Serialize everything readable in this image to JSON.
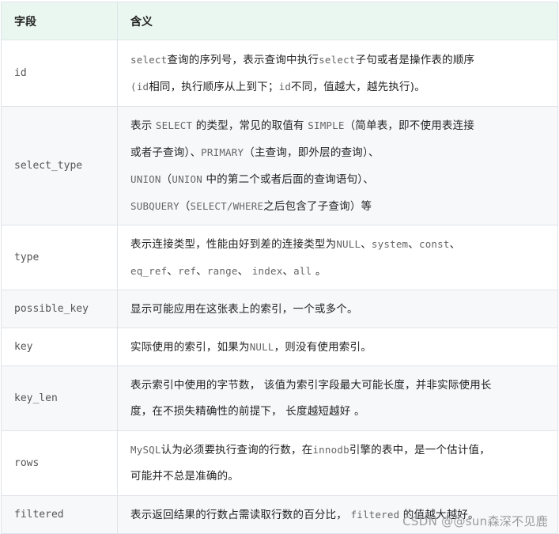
{
  "table": {
    "headers": {
      "field": "字段",
      "meaning": "含义"
    },
    "rows": [
      {
        "field": "id",
        "lines": [
          [
            {
              "t": "select",
              "code": true
            },
            {
              "t": "查询的序列号，表示查询中执行"
            },
            {
              "t": "select",
              "code": true
            },
            {
              "t": "子句或者是操作表的顺序"
            }
          ],
          [
            {
              "t": "(",
              "code": true
            },
            {
              "t": "id",
              "code": true
            },
            {
              "t": "相同，执行顺序从上到下；"
            },
            {
              "t": "id",
              "code": true
            },
            {
              "t": "不同，值越大，越先执行)。"
            }
          ]
        ]
      },
      {
        "field": "select_type",
        "lines": [
          [
            {
              "t": "表示 "
            },
            {
              "t": "SELECT",
              "code": true
            },
            {
              "t": " 的类型，常见的取值有 "
            },
            {
              "t": "SIMPLE",
              "code": true
            },
            {
              "t": "（简单表，即不使用表连接"
            }
          ],
          [
            {
              "t": "或者子查询）、"
            },
            {
              "t": "PRIMARY",
              "code": true
            },
            {
              "t": "（主查询，即外层的查询）、"
            }
          ],
          [
            {
              "t": "UNION",
              "code": true
            },
            {
              "t": "（"
            },
            {
              "t": "UNION",
              "code": true
            },
            {
              "t": " 中的第二个或者后面的查询语句）、"
            }
          ],
          [
            {
              "t": "SUBQUERY",
              "code": true
            },
            {
              "t": "（"
            },
            {
              "t": "SELECT/WHERE",
              "code": true
            },
            {
              "t": "之后包含了子查询）等"
            }
          ]
        ]
      },
      {
        "field": "type",
        "lines": [
          [
            {
              "t": "表示连接类型，性能由好到差的连接类型为"
            },
            {
              "t": "NULL",
              "code": true
            },
            {
              "t": "、"
            },
            {
              "t": "system",
              "code": true
            },
            {
              "t": "、"
            },
            {
              "t": "const",
              "code": true
            },
            {
              "t": "、"
            }
          ],
          [
            {
              "t": "eq_ref",
              "code": true
            },
            {
              "t": "、"
            },
            {
              "t": "ref",
              "code": true
            },
            {
              "t": "、"
            },
            {
              "t": "range",
              "code": true
            },
            {
              "t": "、 "
            },
            {
              "t": "index",
              "code": true
            },
            {
              "t": "、"
            },
            {
              "t": "all",
              "code": true
            },
            {
              "t": " 。"
            }
          ]
        ]
      },
      {
        "field": "possible_key",
        "lines": [
          [
            {
              "t": "显示可能应用在这张表上的索引，一个或多个。"
            }
          ]
        ]
      },
      {
        "field": "key",
        "lines": [
          [
            {
              "t": "实际使用的索引，如果为"
            },
            {
              "t": "NULL",
              "code": true
            },
            {
              "t": "，则没有使用索引。"
            }
          ]
        ]
      },
      {
        "field": "key_len",
        "lines": [
          [
            {
              "t": "表示索引中使用的字节数， 该值为索引字段最大可能长度，并非实际使用长"
            }
          ],
          [
            {
              "t": "度，在不损失精确性的前提下， 长度越短越好 。"
            }
          ]
        ]
      },
      {
        "field": "rows",
        "lines": [
          [
            {
              "t": "MySQL",
              "code": true
            },
            {
              "t": "认为必须要执行查询的行数，在"
            },
            {
              "t": "innodb",
              "code": true
            },
            {
              "t": "引擎的表中，是一个估计值，"
            }
          ],
          [
            {
              "t": "可能并不总是准确的。"
            }
          ]
        ]
      },
      {
        "field": "filtered",
        "lines": [
          [
            {
              "t": "表示返回结果的行数占需读取行数的百分比， "
            },
            {
              "t": "filtered",
              "code": true
            },
            {
              "t": " 的值越大越好。"
            }
          ]
        ]
      }
    ]
  },
  "watermark": "CSDN @@sun森深不见鹿"
}
